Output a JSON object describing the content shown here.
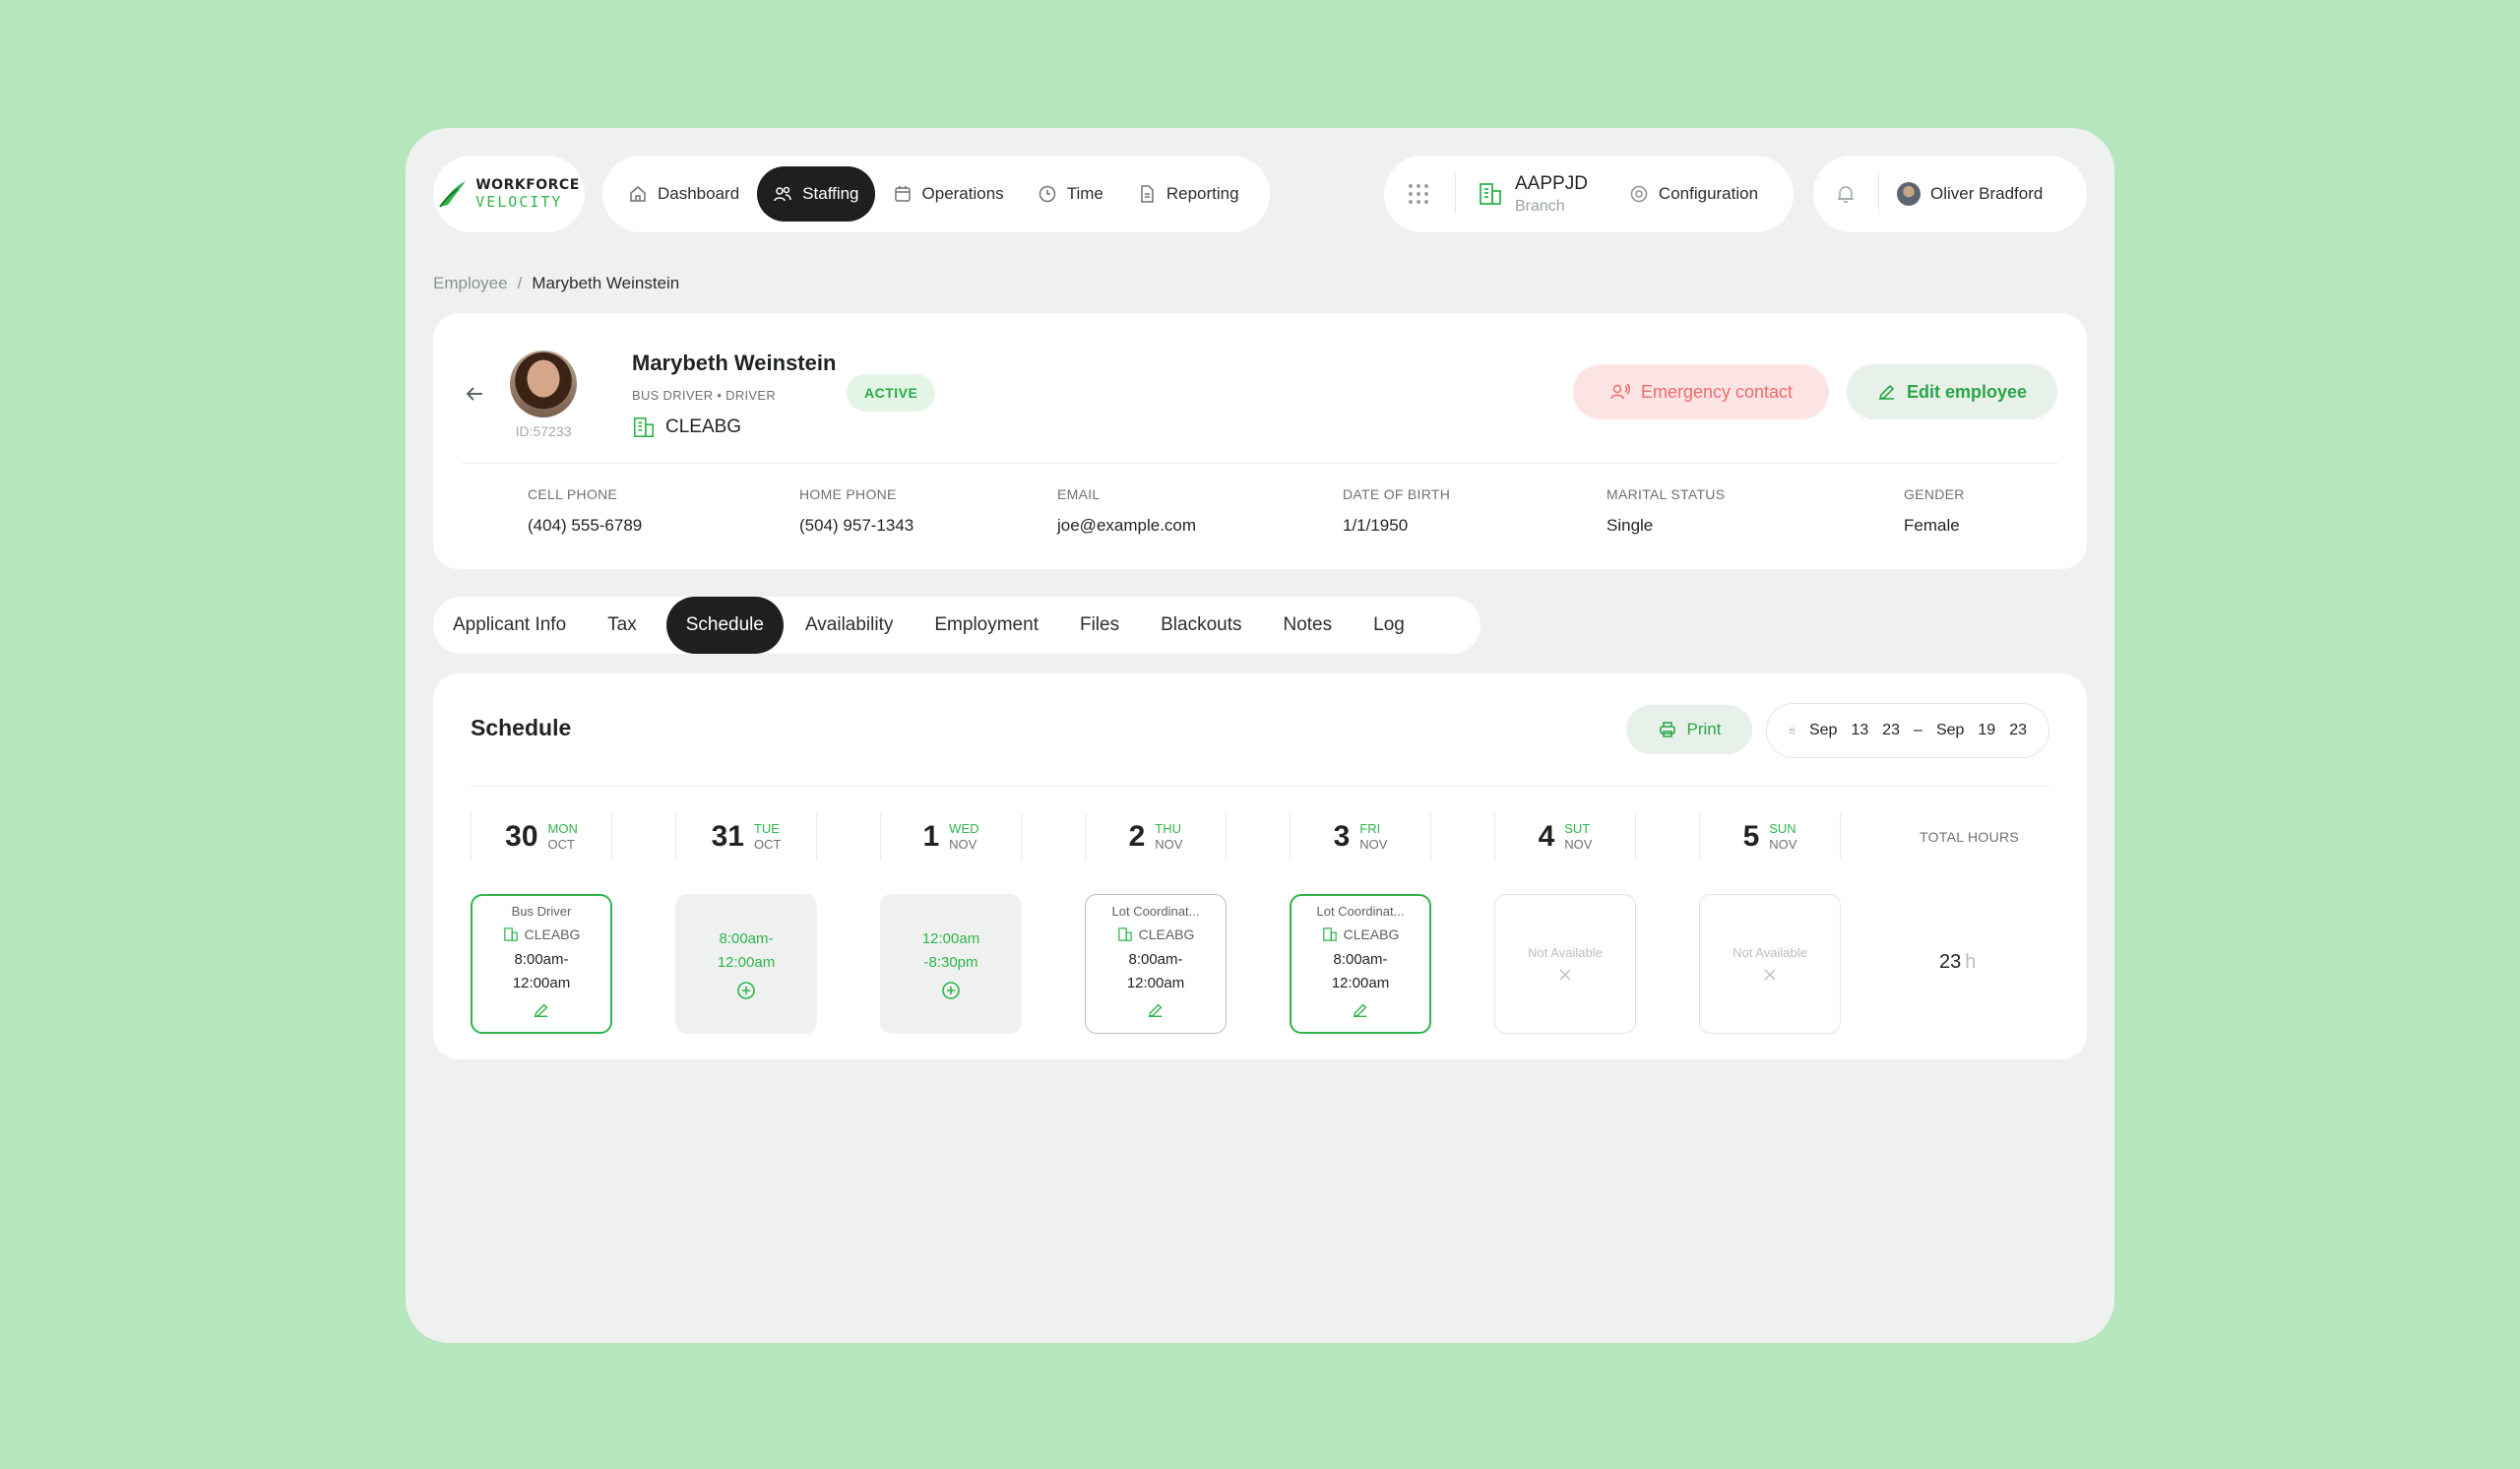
{
  "brand": {
    "line1": "WORKFORCE",
    "line2": "VELOCITY"
  },
  "nav": [
    {
      "label": "Dashboard",
      "icon": "home-icon"
    },
    {
      "label": "Staffing",
      "icon": "users-icon",
      "active": true
    },
    {
      "label": "Operations",
      "icon": "calendar-icon"
    },
    {
      "label": "Time",
      "icon": "clock-icon"
    },
    {
      "label": "Reporting",
      "icon": "document-icon"
    }
  ],
  "branch": {
    "code": "AAPPJD",
    "label": "Branch"
  },
  "config_label": "Configuration",
  "user": {
    "name": "Oliver Bradford"
  },
  "breadcrumb": {
    "parent": "Employee",
    "separator": "/",
    "current": "Marybeth Weinstein"
  },
  "employee": {
    "name": "Marybeth Weinstein",
    "id": "ID:57233",
    "role": "BUS DRIVER • DRIVER",
    "branch": "CLEABG",
    "status": "ACTIVE",
    "fields": [
      {
        "label": "CELL PHONE",
        "value": "(404) 555-6789"
      },
      {
        "label": "HOME PHONE",
        "value": "(504) 957-1343"
      },
      {
        "label": "EMAIL",
        "value": "joe@example.com"
      },
      {
        "label": "DATE OF BIRTH",
        "value": "1/1/1950"
      },
      {
        "label": "MARITAL STATUS",
        "value": "Single"
      },
      {
        "label": "GENDER",
        "value": "Female"
      }
    ]
  },
  "actions": {
    "emergency": "Emergency contact",
    "edit": "Edit employee"
  },
  "tabs": [
    "Applicant Info",
    "Tax",
    "Schedule",
    "Availability",
    "Employment",
    "Files",
    "Blackouts",
    "Notes",
    "Log"
  ],
  "active_tab": "Schedule",
  "schedule": {
    "title": "Schedule",
    "print_label": "Print",
    "range": {
      "start_mon": "Sep",
      "start_day": "13",
      "start_yr": "23",
      "dash": "–",
      "end_mon": "Sep",
      "end_day": "19",
      "end_yr": "23"
    },
    "total_label": "TOTAL HOURS",
    "total_value": "23",
    "total_unit": "h",
    "days": [
      {
        "num": "30",
        "dow": "MON",
        "mon": "OCT"
      },
      {
        "num": "31",
        "dow": "TUE",
        "mon": "OCT"
      },
      {
        "num": "1",
        "dow": "WED",
        "mon": "NOV"
      },
      {
        "num": "2",
        "dow": "THU",
        "mon": "NOV"
      },
      {
        "num": "3",
        "dow": "FRI",
        "mon": "NOV"
      },
      {
        "num": "4",
        "dow": "SUT",
        "mon": "NOV"
      },
      {
        "num": "5",
        "dow": "SUN",
        "mon": "NOV"
      }
    ],
    "cells": [
      {
        "type": "shift",
        "role": "Bus Driver",
        "branch": "CLEABG",
        "time1": "8:00am-",
        "time2": "12:00am"
      },
      {
        "type": "open",
        "time1": "8:00am-",
        "time2": "12:00am"
      },
      {
        "type": "open",
        "time1": "12:00am",
        "time2": "-8:30pm"
      },
      {
        "type": "shift-gray",
        "role": "Lot Coordinat...",
        "branch": "CLEABG",
        "time1": "8:00am-",
        "time2": "12:00am"
      },
      {
        "type": "shift",
        "role": "Lot Coordinat...",
        "branch": "CLEABG",
        "time1": "8:00am-",
        "time2": "12:00am"
      },
      {
        "type": "na",
        "label": "Not Available"
      },
      {
        "type": "na",
        "label": "Not Available"
      }
    ]
  },
  "colors": {
    "accent": "#2fb54b",
    "dark": "#1f1f1f",
    "background": "#b5e6bd",
    "danger": "#ee6b6b"
  }
}
